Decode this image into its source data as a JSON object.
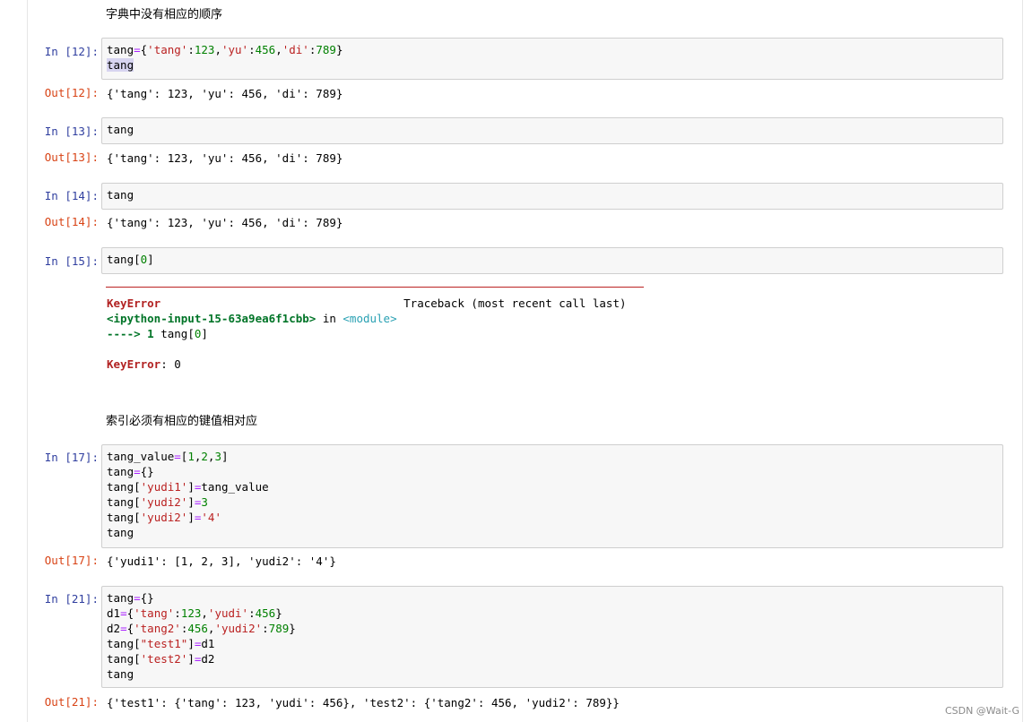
{
  "markdown": {
    "dict_no_order": "字典中没有相应的顺序",
    "index_must_match": "索引必须有相应的键值相对应"
  },
  "cells": [
    {
      "in": "In  [12]:",
      "out": "Out[12]:",
      "out_text": "{'tang': 123, 'yu': 456, 'di': 789}"
    },
    {
      "in": "In  [13]:",
      "out": "Out[13]:",
      "out_text": "{'tang': 123, 'yu': 456, 'di': 789}",
      "code": "tang"
    },
    {
      "in": "In  [14]:",
      "out": "Out[14]:",
      "out_text": "{'tang': 123, 'yu': 456, 'di': 789}",
      "code": "tang"
    },
    {
      "in": "In  [15]:"
    },
    {
      "in": "In  [17]:",
      "out": "Out[17]:",
      "out_text": "{'yudi1': [1, 2, 3], 'yudi2': '4'}"
    },
    {
      "in": "In  [21]:",
      "out": "Out[21]:",
      "out_text": "{'test1': {'tang': 123, 'yudi': 456}, 'test2': {'tang2': 456, 'yudi2': 789}}"
    }
  ],
  "traceback": {
    "error_name": "KeyError",
    "header_right": "Traceback (most recent call last)",
    "file": "<ipython-input-15-63a9ea6f1cbb>",
    "in_word": " in ",
    "module": "<module>",
    "arrow": "----> 1",
    "final_name": "KeyError",
    "final_msg": ": 0"
  },
  "watermark": "CSDN @Wait-G"
}
